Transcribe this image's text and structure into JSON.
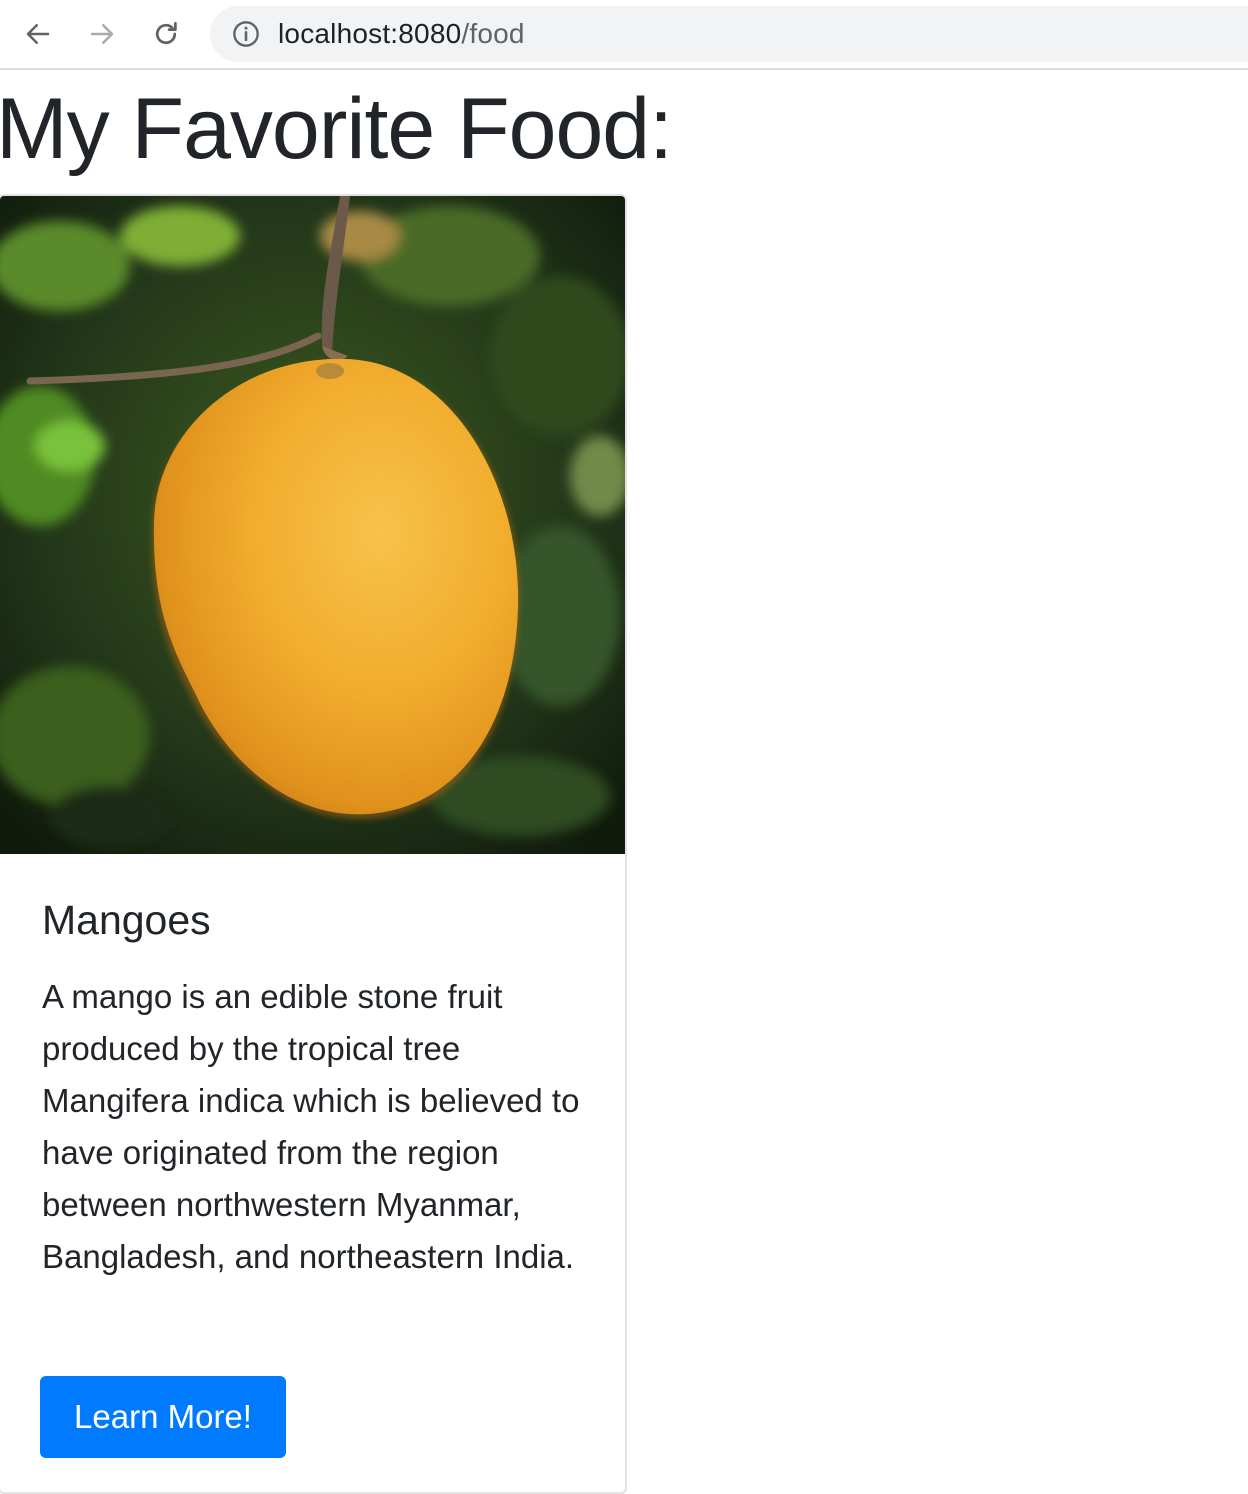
{
  "browser": {
    "url_host": "localhost:8080",
    "url_path": "/food"
  },
  "page": {
    "title": "My Favorite Food:"
  },
  "card": {
    "title": "Mangoes",
    "text": "A mango is an edible stone fruit produced by the tropical tree Mangifera indica which is believed to have originated from the region between northwestern Myanmar, Bangladesh, and northeastern India.",
    "button_label": "Learn More!",
    "button_color": "#007bff"
  },
  "icons": [
    "back-arrow-icon",
    "forward-arrow-icon",
    "reload-icon",
    "info-icon"
  ]
}
